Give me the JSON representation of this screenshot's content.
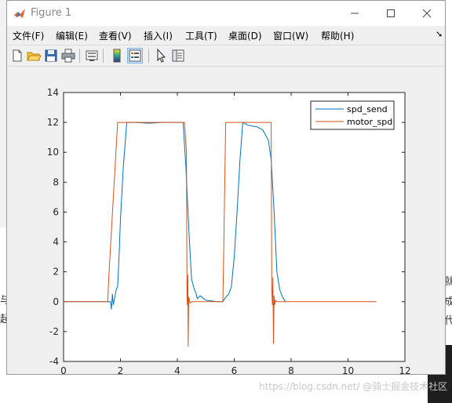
{
  "window": {
    "title": "Figure 1"
  },
  "menu": [
    {
      "label": "文件(F)"
    },
    {
      "label": "编辑(E)"
    },
    {
      "label": "查看(V)"
    },
    {
      "label": "插入(I)"
    },
    {
      "label": "工具(T)"
    },
    {
      "label": "桌面(D)"
    },
    {
      "label": "窗口(W)"
    },
    {
      "label": "帮助(H)"
    }
  ],
  "toolbar": [
    {
      "icon": "new-figure-icon"
    },
    {
      "icon": "open-file-icon"
    },
    {
      "icon": "save-icon"
    },
    {
      "icon": "print-icon"
    },
    {
      "icon": "link-plot-icon"
    },
    {
      "icon": "insert-colorbar-icon"
    },
    {
      "icon": "insert-legend-icon"
    },
    {
      "icon": "edit-plot-pointer-icon"
    },
    {
      "icon": "property-inspector-icon"
    }
  ],
  "watermark": "https://blog.csdn.net/ @骑士掘金技术社区",
  "chart_data": {
    "type": "line",
    "title": "",
    "xlabel": "",
    "ylabel": "",
    "xlim": [
      0,
      12
    ],
    "ylim": [
      -4,
      14
    ],
    "xticks": [
      "0",
      "2",
      "4",
      "6",
      "8",
      "10",
      "12"
    ],
    "yticks": [
      "-4",
      "-2",
      "0",
      "2",
      "4",
      "6",
      "8",
      "10",
      "12",
      "14"
    ],
    "grid": false,
    "legend_position": "top-right",
    "series": [
      {
        "name": "spd_send",
        "color": "#0072BD",
        "x": [
          0,
          1.65,
          1.68,
          1.72,
          1.75,
          1.8,
          1.85,
          1.9,
          1.95,
          2.0,
          2.1,
          2.2,
          2.22,
          2.5,
          3.0,
          3.5,
          4.0,
          4.2,
          4.3,
          4.4,
          4.5,
          4.6,
          4.65,
          4.7,
          4.8,
          5.0,
          5.4,
          5.6,
          5.7,
          5.8,
          5.9,
          6.0,
          6.1,
          6.2,
          6.3,
          6.5,
          6.8,
          7.0,
          7.2,
          7.3,
          7.4,
          7.5,
          7.6,
          7.7,
          7.8,
          7.82
        ],
        "y": [
          0,
          0,
          -0.5,
          0.5,
          -0.2,
          0.3,
          0.8,
          1.0,
          3.0,
          5.5,
          9.0,
          11.5,
          12.0,
          12.0,
          11.95,
          12.0,
          12.0,
          12.0,
          9.0,
          5.0,
          1.5,
          0.8,
          0.6,
          0.2,
          0.4,
          0.1,
          0.0,
          0.0,
          0.3,
          0.5,
          1.0,
          3.0,
          6.0,
          9.5,
          12.0,
          11.8,
          11.7,
          11.5,
          10.8,
          9.5,
          6.0,
          2.0,
          0.8,
          0.3,
          0.0,
          0.0
        ]
      },
      {
        "name": "motor_spd",
        "color": "#D95319",
        "x": [
          0,
          1.55,
          1.6,
          1.9,
          3.0,
          4.25,
          4.32,
          4.34,
          4.35,
          4.37,
          4.38,
          4.4,
          4.45,
          4.5,
          5.3,
          5.6,
          5.62,
          5.7,
          6.3,
          6.6,
          7.3,
          7.32,
          7.34,
          7.36,
          7.38,
          7.4,
          7.42,
          7.45,
          7.5,
          11.0
        ],
        "y": [
          0,
          0,
          2.0,
          12.0,
          12.0,
          12.0,
          10.0,
          0.5,
          -0.2,
          1.8,
          -3.0,
          0.3,
          -0.1,
          0.0,
          0.0,
          0.0,
          2.0,
          12.0,
          12.0,
          12.0,
          12.0,
          1.0,
          -0.2,
          1.6,
          -2.8,
          0.4,
          -0.2,
          0.1,
          0.0,
          0.0
        ]
      }
    ]
  }
}
